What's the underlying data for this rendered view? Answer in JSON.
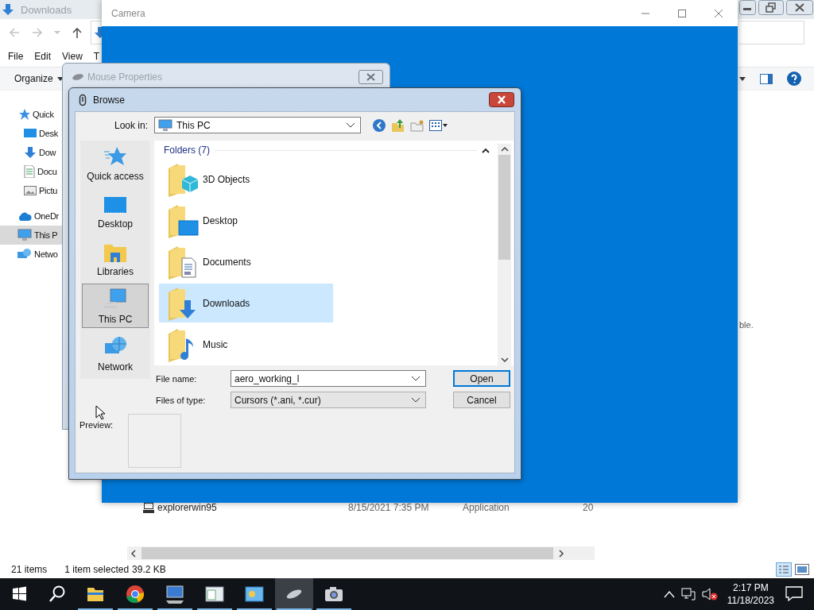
{
  "explorer": {
    "title": "Downloads",
    "menu": [
      "File",
      "Edit",
      "View",
      "T"
    ],
    "toolbar": {
      "organize": "Organize"
    },
    "nav": [
      {
        "label": "Quick",
        "selected": false,
        "children": [
          {
            "label": "Desk",
            "selected": false
          },
          {
            "label": "Dow",
            "selected": false
          },
          {
            "label": "Docu",
            "selected": false
          },
          {
            "label": "Pictu",
            "selected": false
          }
        ]
      },
      {
        "label": "OneDr",
        "selected": false
      },
      {
        "label": "This P",
        "selected": true
      },
      {
        "label": "Netwo",
        "selected": false
      }
    ],
    "content_text": "ble.",
    "file_row": {
      "name": "explorerwin95",
      "modified": "8/15/2021 7:35 PM",
      "type": "Application",
      "column_4": "20"
    },
    "status": {
      "items": "21 items",
      "selection": "1 item selected",
      "size": "39.2 KB"
    }
  },
  "camera": {
    "title": "Camera"
  },
  "mouse_properties": {
    "title": "Mouse Properties"
  },
  "browse": {
    "title": "Browse",
    "look_in": {
      "label": "Look in:",
      "value": "This PC"
    },
    "places": [
      {
        "label": "Quick access",
        "selected": false
      },
      {
        "label": "Desktop",
        "selected": false
      },
      {
        "label": "Libraries",
        "selected": false
      },
      {
        "label": "This PC",
        "selected": true
      },
      {
        "label": "Network",
        "selected": false
      }
    ],
    "group": "Folders (7)",
    "folders": [
      {
        "name": "3D Objects",
        "selected": false
      },
      {
        "name": "Desktop",
        "selected": false
      },
      {
        "name": "Documents",
        "selected": false
      },
      {
        "name": "Downloads",
        "selected": true
      },
      {
        "name": "Music",
        "selected": false
      }
    ],
    "file_name": {
      "label": "File name:",
      "value": "aero_working_l"
    },
    "file_type": {
      "label": "Files of type:",
      "value": "Cursors (*.ani, *.cur)"
    },
    "buttons": [
      "Open",
      "Cancel"
    ],
    "preview_label": "Preview:"
  },
  "taskbar": {
    "apps": [
      {
        "selected": false
      },
      {
        "selected": false
      },
      {
        "selected": false
      },
      {
        "selected": false
      },
      {
        "selected": false
      },
      {
        "selected": true
      },
      {
        "selected": false
      }
    ],
    "time": "2:17 PM",
    "date": "11/18/2023"
  }
}
